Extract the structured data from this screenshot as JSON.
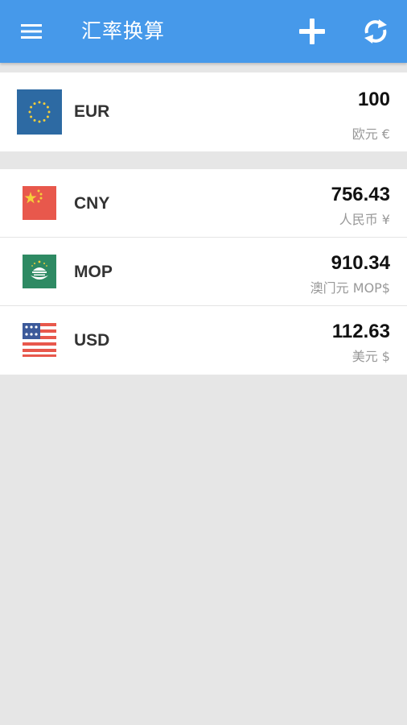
{
  "appbar": {
    "title": "汇率换算",
    "menu_icon": "hamburger-menu-icon",
    "add_icon": "plus-icon",
    "refresh_icon": "refresh-icon",
    "color": "#4699ea"
  },
  "base_currency": {
    "code": "EUR",
    "amount": "100",
    "name": "欧元 €",
    "flag_icon": "eu-flag-icon"
  },
  "currencies": [
    {
      "code": "CNY",
      "amount": "756.43",
      "name": "人民币 ¥",
      "flag_icon": "china-flag-icon"
    },
    {
      "code": "MOP",
      "amount": "910.34",
      "name": "澳门元 MOP$",
      "flag_icon": "macau-flag-icon"
    },
    {
      "code": "USD",
      "amount": "112.63",
      "name": "美元 $",
      "flag_icon": "usa-flag-icon"
    }
  ]
}
